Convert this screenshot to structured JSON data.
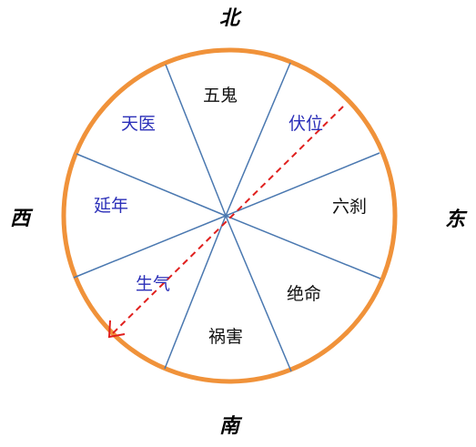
{
  "directions": {
    "north": "北",
    "south": "南",
    "east": "东",
    "west": "西"
  },
  "sectors": [
    {
      "label": "五鬼",
      "color": "#111111"
    },
    {
      "label": "伏位",
      "color": "#2b2fb8"
    },
    {
      "label": "六刹",
      "color": "#111111"
    },
    {
      "label": "绝命",
      "color": "#111111"
    },
    {
      "label": "祸害",
      "color": "#111111"
    },
    {
      "label": "生气",
      "color": "#2b2fb8"
    },
    {
      "label": "延年",
      "color": "#2b2fb8"
    },
    {
      "label": "天医",
      "color": "#2b2fb8"
    }
  ],
  "colors": {
    "ring": "#f0923a",
    "spokes": "#4a78b0",
    "arrow": "#e0201e"
  }
}
